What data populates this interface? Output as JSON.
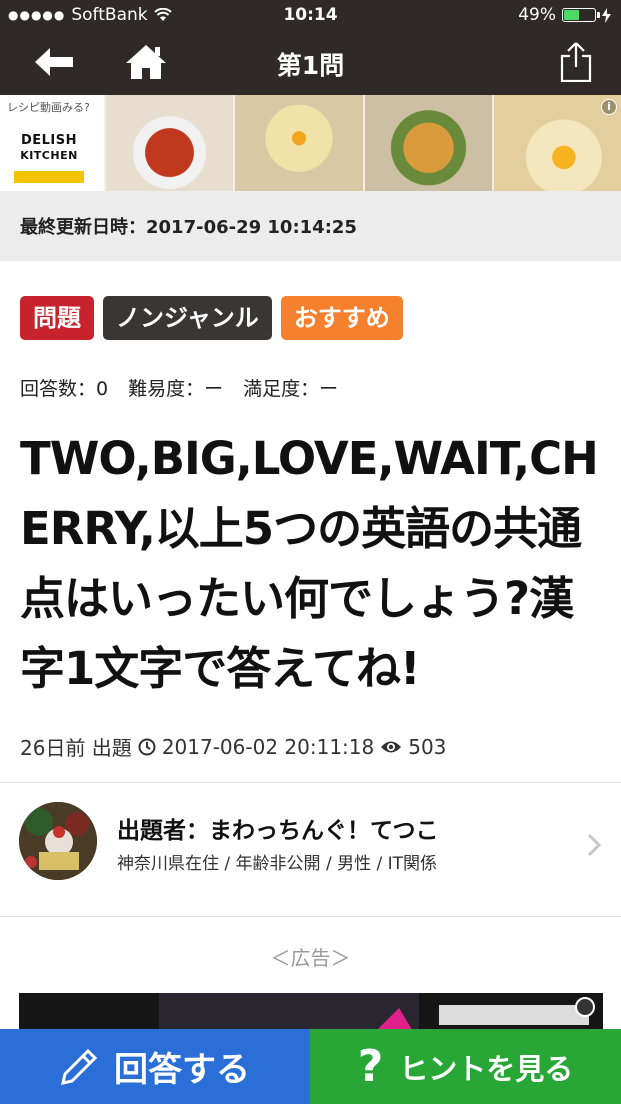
{
  "status_bar": {
    "carrier": "SoftBank",
    "time": "10:14",
    "battery_percent": "49%",
    "battery_level": 0.49
  },
  "nav": {
    "title": "第1問",
    "back_icon": "back-arrow-icon",
    "home_icon": "home-icon",
    "share_icon": "share-icon"
  },
  "ad_banner": {
    "tagline": "レシピ動画みる?",
    "brand_line1": "DELISH",
    "brand_line2": "KITCHEN",
    "info": "i"
  },
  "updated": {
    "text": "最終更新日時：2017-06-29 10:14:25"
  },
  "tags": [
    {
      "label": "問題",
      "color": "#c8222d"
    },
    {
      "label": "ノンジャンル",
      "color": "#3a3634"
    },
    {
      "label": "おすすめ",
      "color": "#f5812f"
    }
  ],
  "stats": {
    "answers": "回答数：0",
    "difficulty": "難易度：ー",
    "satisfaction": "満足度：ー"
  },
  "question": {
    "text": "TWO,BIG,LOVE,WAIT,CHERRY,以上5つの英語の共通点はいったい何でしょう?漢字1文字で答えてね!"
  },
  "meta": {
    "posted": "26日前 出題",
    "datetime": "2017-06-02 20:11:18",
    "views": "503"
  },
  "author": {
    "name": "出題者：まわっちんぐ！てつこ",
    "info": "神奈川県在住 / 年齢非公開 / 男性 / IT関係"
  },
  "ad_label": "＜広告＞",
  "bottom": {
    "answer_label": "回答する",
    "hint_label": "ヒントを見る",
    "hint_symbol": "?"
  }
}
